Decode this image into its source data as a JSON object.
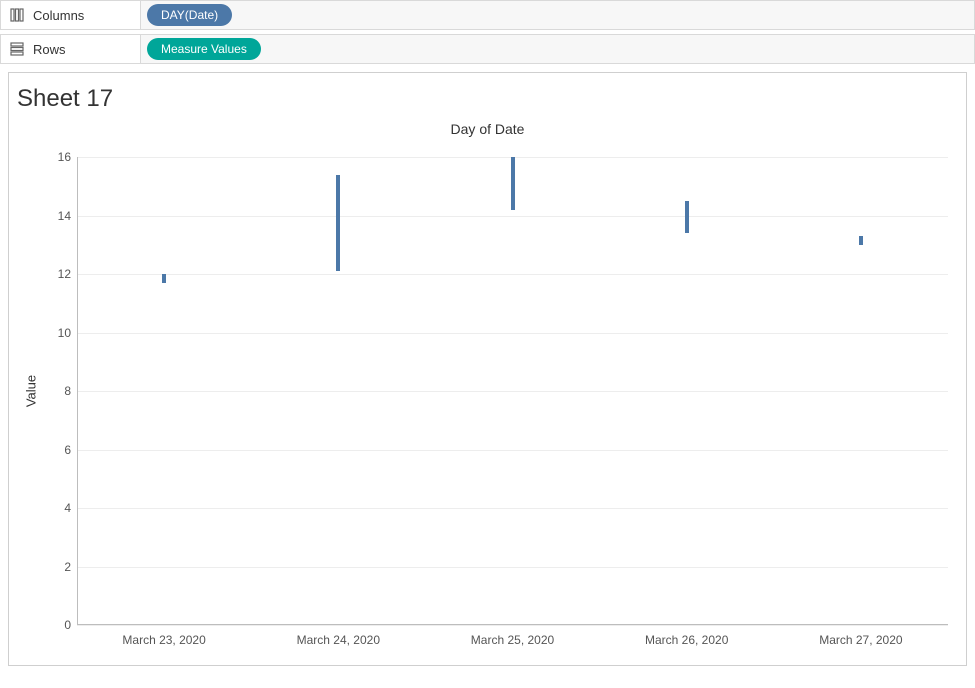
{
  "shelves": {
    "columns": {
      "label": "Columns",
      "pill": "DAY(Date)"
    },
    "rows": {
      "label": "Rows",
      "pill": "Measure Values"
    }
  },
  "sheet": {
    "title": "Sheet 17"
  },
  "chart_data": {
    "type": "bar",
    "title": "Day of Date",
    "ylabel": "Value",
    "xlabel": "",
    "ylim": [
      0,
      16
    ],
    "yticks": [
      0,
      2,
      4,
      6,
      8,
      10,
      12,
      14,
      16
    ],
    "categories": [
      "March 23, 2020",
      "March 24, 2020",
      "March 25, 2020",
      "March 26, 2020",
      "March 27, 2020"
    ],
    "series": [
      {
        "name": "range",
        "low": [
          11.7,
          12.1,
          14.2,
          13.4,
          13.0
        ],
        "high": [
          12.0,
          15.4,
          16.0,
          14.5,
          13.3
        ]
      }
    ]
  }
}
